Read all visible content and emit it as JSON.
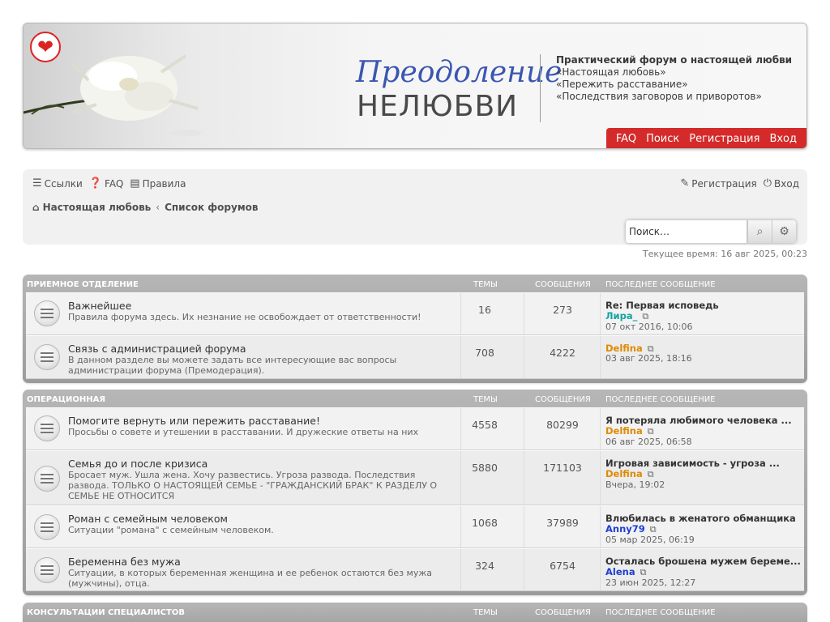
{
  "header": {
    "brand_top": "Преодоление",
    "brand_bottom": "НЕЛЮБВИ",
    "desc_lead": "Практический форум о настоящей любви",
    "desc_lines": [
      "«Настоящая любовь»",
      "«Пережить расставание»",
      "«Последствия заговоров и приворотов»"
    ],
    "menu": [
      "FAQ",
      "Поиск",
      "Регистрация",
      "Вход"
    ]
  },
  "navbar": {
    "links": [
      "Ссылки",
      "FAQ",
      "Правила"
    ],
    "right_links": [
      "Регистрация",
      "Вход"
    ],
    "breadcrumb": [
      "Настоящая любовь",
      "Список форумов"
    ],
    "search_placeholder": "Поиск…"
  },
  "current_time": "Текущее время: 16 авг 2025, 00:23",
  "headers": {
    "topics": "Темы",
    "posts": "Сообщения",
    "last": "Последнее сообщение"
  },
  "categories": [
    {
      "name": "Приемное отделение",
      "forums": [
        {
          "title": "Важнейшее",
          "desc": "Правила форума здесь. Их незнание не освобождает от ответственности!",
          "topics": "16",
          "posts": "273",
          "last_title": "Re: Первая исповедь",
          "last_user": "Лира_",
          "last_user_color": "#17a2a2",
          "last_date": "07 окт 2016, 10:06"
        },
        {
          "title": "Связь с администрацией форума",
          "desc": "В данном разделе вы можете задать все интересующие вас вопросы администрации форума (Премодерация).",
          "topics": "708",
          "posts": "4222",
          "last_title": "",
          "last_user": "Delfina",
          "last_user_color": "#e08a00",
          "last_date": "03 авг 2025, 18:16"
        }
      ]
    },
    {
      "name": "Операционная",
      "forums": [
        {
          "title": "Помогите вернуть или пережить расставание!",
          "desc": "Просьбы о совете и утешении в расставании. И дружеские ответы на них",
          "topics": "4558",
          "posts": "80299",
          "last_title": "Я потеряла любимого человека ...",
          "last_user": "Delfina",
          "last_user_color": "#e08a00",
          "last_date": "06 авг 2025, 06:58"
        },
        {
          "title": "Семья до и после кризиса",
          "desc": "Бросает муж. Ушла жена. Хочу развестись. Угроза развода. Последствия развода. ТОЛЬКО О НАСТОЯЩЕЙ СЕМЬЕ - \"ГРАЖДАНСКИЙ БРАК\" К РАЗДЕЛУ О СЕМЬЕ НЕ ОТНОСИТСЯ",
          "topics": "5880",
          "posts": "171103",
          "last_title": "Игровая зависимость - угроза ...",
          "last_user": "Delfina",
          "last_user_color": "#e08a00",
          "last_date": "Вчера, 19:02"
        },
        {
          "title": "Роман с семейным человеком",
          "desc": "Ситуации \"романа\" с семейным человеком.",
          "topics": "1068",
          "posts": "37989",
          "last_title": "Влюбилась в женатого обманщика",
          "last_user": "Anny79",
          "last_user_color": "#1e3fd0",
          "last_date": "05 мар 2025, 06:19"
        },
        {
          "title": "Беременна без мужа",
          "desc": "Ситуации, в которых беременная женщина и ее ребенок остаются без мужа (мужчины), отца.",
          "topics": "324",
          "posts": "6754",
          "last_title": "Осталась брошена мужем береме...",
          "last_user": "Alena",
          "last_user_color": "#1e3fd0",
          "last_date": "23 июн 2025, 12:27"
        }
      ]
    },
    {
      "name": "Консультации специалистов",
      "forums": []
    }
  ]
}
